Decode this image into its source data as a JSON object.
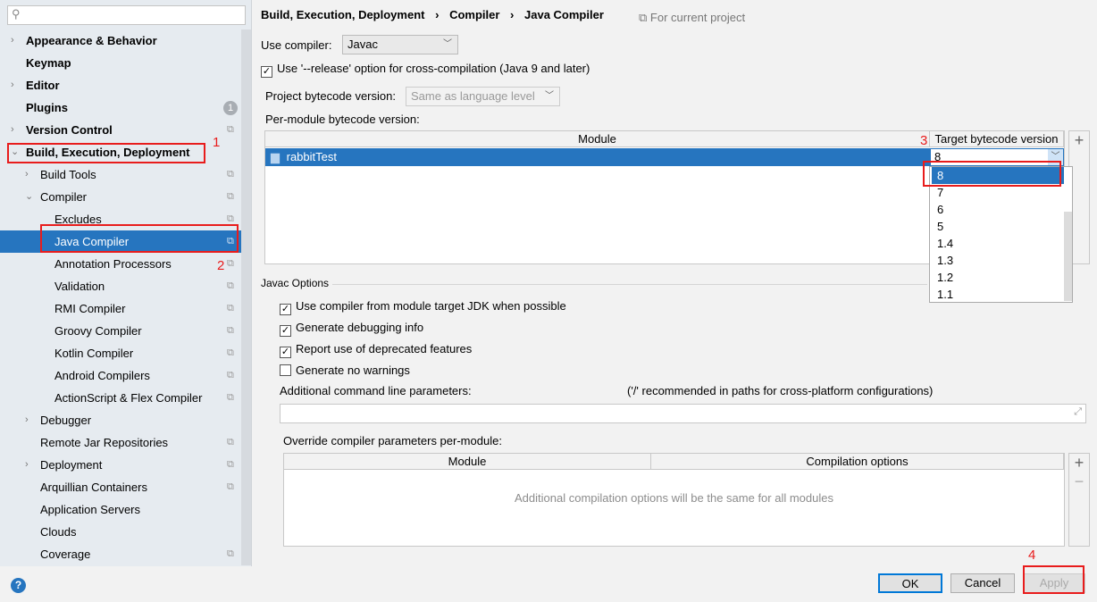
{
  "sidebar": {
    "items": [
      {
        "label": "Appearance & Behavior",
        "level": 0,
        "arrow": "right",
        "bold": true
      },
      {
        "label": "Keymap",
        "level": 0,
        "bold": true
      },
      {
        "label": "Editor",
        "level": 0,
        "arrow": "right",
        "bold": true
      },
      {
        "label": "Plugins",
        "level": 0,
        "bold": true,
        "badge": "1"
      },
      {
        "label": "Version Control",
        "level": 0,
        "arrow": "right",
        "bold": true,
        "copy": true
      },
      {
        "label": "Build, Execution, Deployment",
        "level": 0,
        "arrow": "down",
        "bold": true
      },
      {
        "label": "Build Tools",
        "level": 1,
        "arrow": "right",
        "copy": true
      },
      {
        "label": "Compiler",
        "level": 1,
        "arrow": "down",
        "copy": true
      },
      {
        "label": "Excludes",
        "level": 2,
        "copy": true
      },
      {
        "label": "Java Compiler",
        "level": 2,
        "copy": true,
        "selected": true
      },
      {
        "label": "Annotation Processors",
        "level": 2,
        "copy": true
      },
      {
        "label": "Validation",
        "level": 2,
        "copy": true
      },
      {
        "label": "RMI Compiler",
        "level": 2,
        "copy": true
      },
      {
        "label": "Groovy Compiler",
        "level": 2,
        "copy": true
      },
      {
        "label": "Kotlin Compiler",
        "level": 2,
        "copy": true
      },
      {
        "label": "Android Compilers",
        "level": 2,
        "copy": true
      },
      {
        "label": "ActionScript & Flex Compiler",
        "level": 2,
        "copy": true
      },
      {
        "label": "Debugger",
        "level": 1,
        "arrow": "right"
      },
      {
        "label": "Remote Jar Repositories",
        "level": 1,
        "copy": true
      },
      {
        "label": "Deployment",
        "level": 1,
        "arrow": "right",
        "copy": true
      },
      {
        "label": "Arquillian Containers",
        "level": 1,
        "copy": true
      },
      {
        "label": "Application Servers",
        "level": 1
      },
      {
        "label": "Clouds",
        "level": 1
      },
      {
        "label": "Coverage",
        "level": 1,
        "copy": true
      }
    ]
  },
  "breadcrumb": [
    "Build, Execution, Deployment",
    "Compiler",
    "Java Compiler"
  ],
  "breadcrumb_sep": "›",
  "scope": "For current project",
  "use_compiler_label": "Use compiler:",
  "use_compiler_value": "Javac",
  "release_option": "Use '--release' option for cross-compilation (Java 9 and later)",
  "project_bytecode_label": "Project bytecode version:",
  "project_bytecode_placeholder": "Same as language level",
  "per_module_label": "Per-module bytecode version:",
  "module_table": {
    "headers": [
      "Module",
      "Target bytecode version"
    ],
    "rows": [
      {
        "module": "rabbitTest",
        "target": "8"
      }
    ]
  },
  "dropdown_options": [
    "8",
    "7",
    "6",
    "5",
    "1.4",
    "1.3",
    "1.2",
    "1.1"
  ],
  "javac_section": "Javac Options",
  "options": [
    {
      "label": "Use compiler from module target JDK when possible",
      "checked": true
    },
    {
      "label": "Generate debugging info",
      "checked": true
    },
    {
      "label": "Report use of deprecated features",
      "checked": true
    },
    {
      "label": "Generate no warnings",
      "checked": false
    }
  ],
  "additional_params_label": "Additional command line parameters:",
  "additional_params_hint": "('/' recommended in paths for cross-platform configurations)",
  "override_label": "Override compiler parameters per-module:",
  "override_table": {
    "headers": [
      "Module",
      "Compilation options"
    ],
    "empty": "Additional compilation options will be the same for all modules"
  },
  "buttons": {
    "ok": "OK",
    "cancel": "Cancel",
    "apply": "Apply",
    "help": "?"
  },
  "annotations": [
    "1",
    "2",
    "3",
    "4"
  ],
  "colors": {
    "accent": "#2675bf",
    "annotation": "#e81c1c"
  }
}
